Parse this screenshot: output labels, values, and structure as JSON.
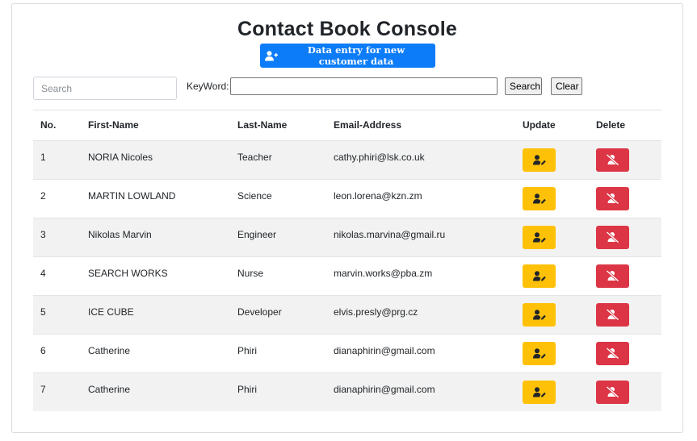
{
  "page": {
    "title": "Contact Book Console",
    "add_button_label": "Data entry for new customer data"
  },
  "search": {
    "placeholder": "Search",
    "keyword_label": "KeyWord:",
    "keyword_value": "",
    "search_button": "Search",
    "clear_button": "Clear"
  },
  "table": {
    "headers": {
      "no": "No.",
      "first": "First-Name",
      "last": "Last-Name",
      "email": "Email-Address",
      "update": "Update",
      "delete": "Delete"
    },
    "rows": [
      {
        "no": "1",
        "first": "NORIA Nicoles",
        "last": "Teacher",
        "email": "cathy.phiri@lsk.co.uk"
      },
      {
        "no": "2",
        "first": "MARTIN LOWLAND",
        "last": "Science",
        "email": "leon.lorena@kzn.zm"
      },
      {
        "no": "3",
        "first": "Nikolas Marvin",
        "last": "Engineer",
        "email": "nikolas.marvina@gmail.ru"
      },
      {
        "no": "4",
        "first": "SEARCH WORKS",
        "last": "Nurse",
        "email": "marvin.works@pba.zm"
      },
      {
        "no": "5",
        "first": "ICE CUBE",
        "last": "Developer",
        "email": "elvis.presly@prg.cz"
      },
      {
        "no": "6",
        "first": "Catherine",
        "last": "Phiri",
        "email": "dianaphirin@gmail.com"
      },
      {
        "no": "7",
        "first": "Catherine",
        "last": "Phiri",
        "email": "dianaphirin@gmail.com"
      }
    ]
  },
  "icons": {
    "add": "user-plus-icon",
    "update": "user-edit-icon",
    "delete": "user-slash-icon"
  },
  "colors": {
    "primary": "#0d7cf8",
    "update": "#ffc107",
    "delete": "#dc3545",
    "stripe": "#f2f2f2"
  }
}
